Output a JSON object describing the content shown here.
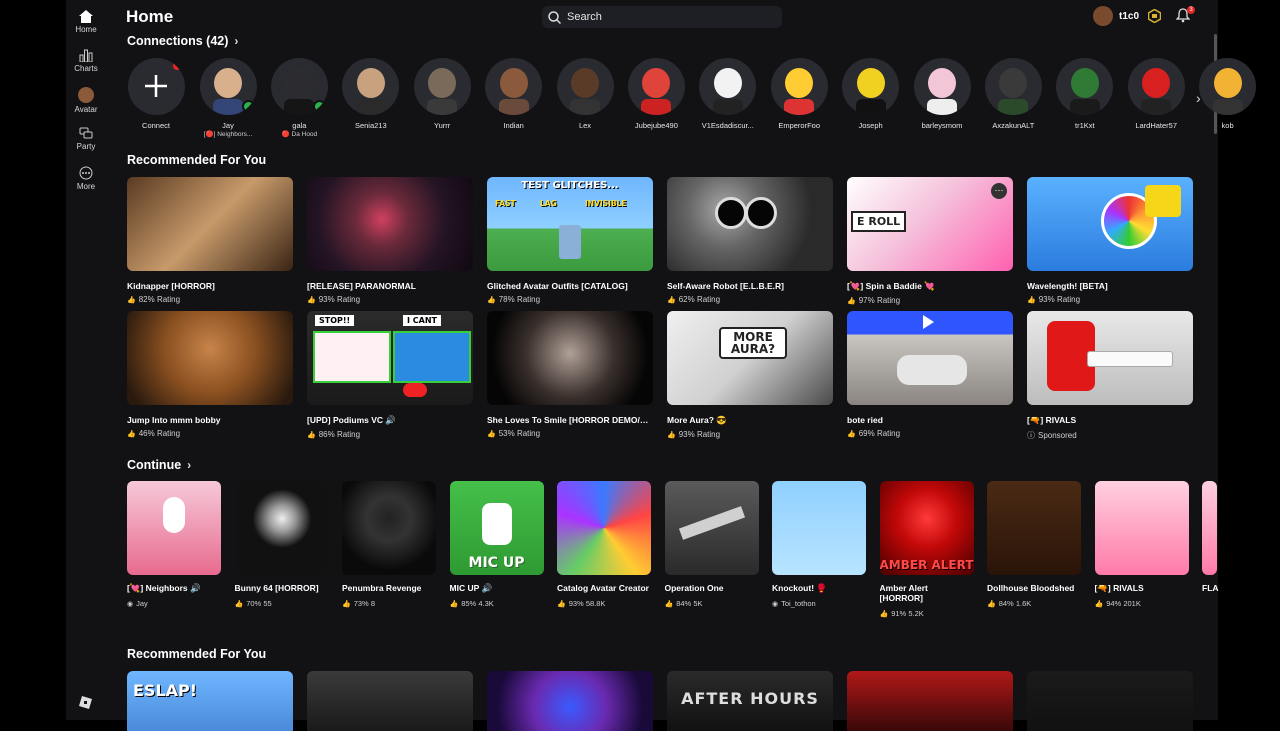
{
  "sidebar": {
    "items": [
      {
        "label": "Home",
        "icon": "home-icon"
      },
      {
        "label": "Charts",
        "icon": "charts-icon"
      },
      {
        "label": "Avatar",
        "icon": "avatar-icon"
      },
      {
        "label": "Party",
        "icon": "party-icon"
      },
      {
        "label": "More",
        "icon": "more-icon"
      }
    ]
  },
  "header": {
    "title": "Home",
    "search_placeholder": "Search",
    "username": "t1c0",
    "notification_count": "3"
  },
  "connections": {
    "title": "Connections (42)",
    "add_label": "Connect",
    "items": [
      {
        "name": "Jay",
        "sub": "[🔴] Neighbors..."
      },
      {
        "name": "gala",
        "sub": "🔴 Da Hood"
      },
      {
        "name": "Senia213",
        "sub": ""
      },
      {
        "name": "Yurrr",
        "sub": ""
      },
      {
        "name": "Indian",
        "sub": ""
      },
      {
        "name": "Lex",
        "sub": ""
      },
      {
        "name": "Jubejube490",
        "sub": ""
      },
      {
        "name": "V1Esdadiscur...",
        "sub": ""
      },
      {
        "name": "EmperorFoo",
        "sub": ""
      },
      {
        "name": "Joseph",
        "sub": ""
      },
      {
        "name": "barleysmom",
        "sub": ""
      },
      {
        "name": "AxzakunALT",
        "sub": ""
      },
      {
        "name": "tr1Kxt",
        "sub": ""
      },
      {
        "name": "LardHater57",
        "sub": ""
      },
      {
        "name": "kob",
        "sub": ""
      }
    ]
  },
  "recommended": {
    "title": "Recommended For You",
    "games": [
      {
        "title": "Kidnapper [HORROR]",
        "rating": "82% Rating"
      },
      {
        "title": "[RELEASE] PARANORMAL",
        "rating": "93% Rating"
      },
      {
        "title": "Glitched Avatar Outfits [CATALOG]",
        "rating": "78% Rating",
        "overlay": "TEST GLITCHES...",
        "tags": [
          "FAST",
          "LAG",
          "INVISIBLE"
        ]
      },
      {
        "title": "Self-Aware Robot [E.L.B.E.R]",
        "rating": "62% Rating"
      },
      {
        "title": "[💘] Spin a Baddie 💘",
        "rating": "97% Rating",
        "overlay": "E ROLL"
      },
      {
        "title": "Wavelength! [BETA]",
        "rating": "93% Rating"
      },
      {
        "title": "Jump Into mmm bobby",
        "rating": "46% Rating"
      },
      {
        "title": "[UPD] Podiums VC 🔊",
        "rating": "86% Rating",
        "overlay_left": "STOP!!",
        "overlay_right": "I CANT"
      },
      {
        "title": "She Loves To Smile [HORROR DEMO/AR...",
        "rating": "53% Rating"
      },
      {
        "title": "More Aura? 😎",
        "rating": "93% Rating",
        "overlay": "MORE AURA?"
      },
      {
        "title": "bote ried",
        "rating": "69% Rating"
      },
      {
        "title": "[🔫] RIVALS",
        "rating": "Sponsored"
      }
    ]
  },
  "continue": {
    "title": "Continue",
    "games": [
      {
        "title": "[💘] Neighbors 🔊",
        "stats": "Jay"
      },
      {
        "title": "Bunny 64 [HORROR]",
        "stats": "70%   55"
      },
      {
        "title": "Penumbra Revenge",
        "stats": "73%   8"
      },
      {
        "title": "MIC UP 🔊",
        "stats": "85%   4.3K",
        "overlay": "MIC UP"
      },
      {
        "title": "Catalog Avatar Creator",
        "stats": "93%   58.8K"
      },
      {
        "title": "Operation One",
        "stats": "84%   5K"
      },
      {
        "title": "Knockout! 🥊",
        "stats": "Toi_tothon"
      },
      {
        "title": "Amber Alert [HORROR]",
        "stats": "91%   5.2K",
        "overlay": "AMBER ALERT"
      },
      {
        "title": "Dollhouse Bloodshed",
        "stats": "84%   1.6K"
      },
      {
        "title": "[🔫] RIVALS",
        "stats": "94%   201K"
      },
      {
        "title": "FLA",
        "stats": ""
      }
    ]
  },
  "recommended2": {
    "title": "Recommended For You",
    "overlays": [
      "ESLAP!",
      "",
      "",
      "AFTER HOURS",
      "",
      ""
    ]
  },
  "colors": {
    "background": "#121215",
    "accent_blue": "#335fff",
    "online_green": "#2bb24c",
    "notification_red": "#e62525"
  }
}
